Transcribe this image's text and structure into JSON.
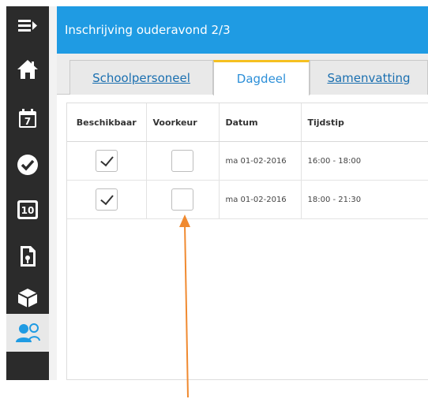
{
  "header": {
    "title": "Inschrijving ouderavond 2/3"
  },
  "sidebar": {
    "items": [
      {
        "icon": "menu-collapse-icon"
      },
      {
        "icon": "home-icon"
      },
      {
        "icon": "calendar-icon",
        "number": "7"
      },
      {
        "icon": "check-circle-icon"
      },
      {
        "icon": "grades-icon",
        "number": "10"
      },
      {
        "icon": "document-icon"
      },
      {
        "icon": "cube-icon"
      },
      {
        "icon": "users-icon",
        "active": true
      }
    ]
  },
  "tabs": [
    {
      "label": "Schoolpersoneel"
    },
    {
      "label": "Dagdeel",
      "active": true
    },
    {
      "label": "Samenvatting"
    }
  ],
  "table": {
    "columns": [
      "Beschikbaar",
      "Voorkeur",
      "Datum",
      "Tijdstip"
    ],
    "rows": [
      {
        "beschikbaar": true,
        "voorkeur": false,
        "datum": "ma 01-02-2016",
        "tijdstip": "16:00 - 18:00"
      },
      {
        "beschikbaar": true,
        "voorkeur": false,
        "datum": "ma 01-02-2016",
        "tijdstip": "18:00 - 21:30"
      }
    ]
  },
  "colors": {
    "header": "#1f9be3",
    "sidebar": "#2b2b2b",
    "active_tab_accent": "#f5c020",
    "annotation_arrow": "#f08a30"
  }
}
